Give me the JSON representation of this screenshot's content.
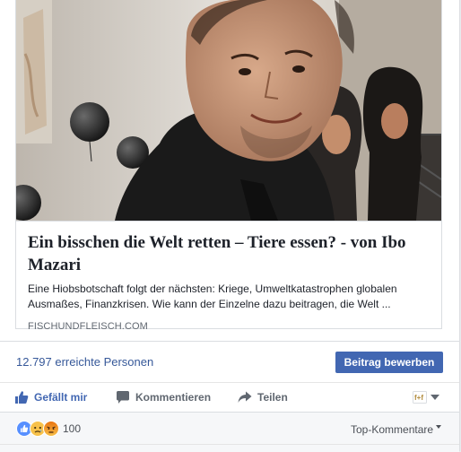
{
  "link_preview": {
    "image_alt": "",
    "title": "Ein bisschen die Welt retten – Tiere essen? - von Ibo Mazari",
    "description": "Eine Hiobsbotschaft folgt der nächsten: Kriege, Umweltkatastrophen globalen Ausmaßes, Finanzkrisen. Wie kann der Einzelne dazu beitragen, die Welt ...",
    "domain": "FISCHUNDFLEISCH.COM"
  },
  "reach": {
    "text": "12.797 erreichte Personen",
    "promote_label": "Beitrag bewerben"
  },
  "actions": {
    "like_label": "Gefällt mir",
    "comment_label": "Kommentieren",
    "share_label": "Teilen",
    "audience_icon": "page-profile-icon"
  },
  "reactions": {
    "icons": [
      "like-icon",
      "sad-icon",
      "angry-icon"
    ],
    "count": "100",
    "sort_label": "Top-Kommentare"
  },
  "colors": {
    "link_blue": "#365899",
    "button_blue": "#4267b2",
    "gray_text": "#606770",
    "sad_yellow": "#f7c14a",
    "angry_orange": "#e9710f"
  }
}
